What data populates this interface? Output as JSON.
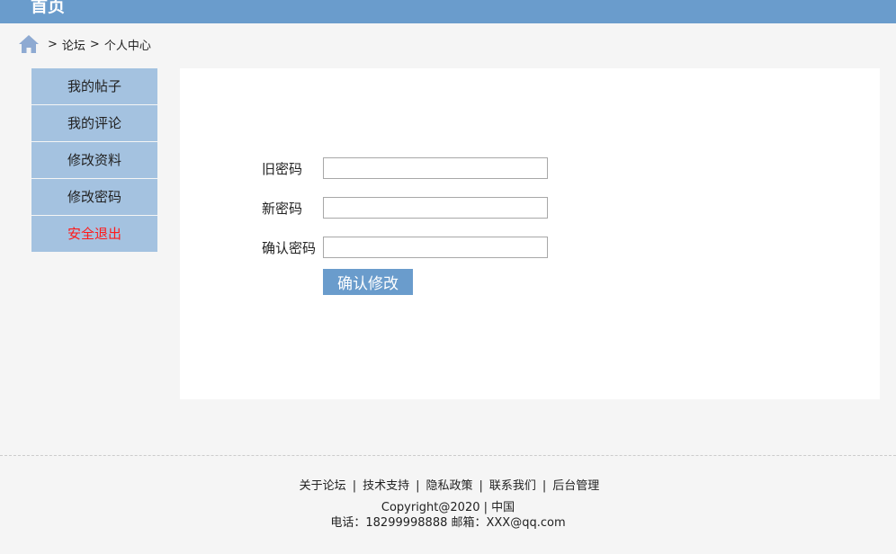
{
  "header": {
    "brand": "首页"
  },
  "breadcrumb": {
    "sep1": ">",
    "item1": "论坛",
    "sep2": ">",
    "item2": "个人中心"
  },
  "sidebar": {
    "items": [
      {
        "label": "我的帖子"
      },
      {
        "label": "我的评论"
      },
      {
        "label": "修改资料"
      },
      {
        "label": "修改密码"
      },
      {
        "label": "安全退出"
      }
    ]
  },
  "form": {
    "old_password_label": "旧密码",
    "new_password_label": "新密码",
    "confirm_password_label": "确认密码",
    "old_password_value": "",
    "new_password_value": "",
    "confirm_password_value": "",
    "submit_label": "确认修改"
  },
  "footer": {
    "links": [
      "关于论坛",
      "技术支持",
      "隐私政策",
      "联系我们",
      "后台管理"
    ],
    "copyright": "Copyright@2020 | 中国",
    "contact": "电话：18299998888 邮箱：XXX@qq.com"
  },
  "colors": {
    "header_bg": "#6a9ccc",
    "sidebar_item_bg": "#a4c2e0",
    "logout_text": "#ff1a1a",
    "button_bg": "#6a9ccc"
  }
}
